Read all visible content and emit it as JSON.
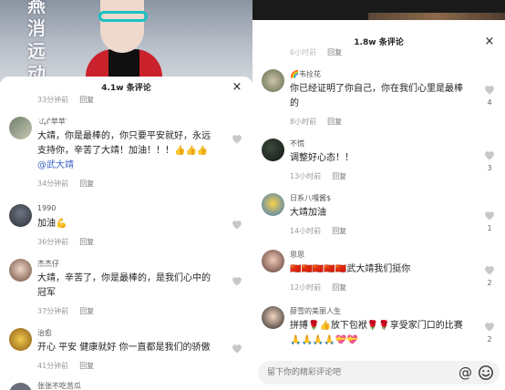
{
  "left": {
    "video_title_art": "燕消远动",
    "sheet_title": "4.1w 条评论",
    "close_glyph": "×",
    "top_meta": {
      "time": "33分钟前",
      "reply": "回复"
    },
    "comments": [
      {
        "name": "ᐝᦔ៹ᒌ苹苹ᐝ",
        "text": "大靖，你是最棒的，你只要平安就好，永远支持你，辛苦了大靖！加油！！！👍👍👍 ",
        "mention": "@武大靖",
        "time": "34分钟前",
        "reply": "回复",
        "likes": ""
      },
      {
        "name": "1990",
        "text": "加油💪",
        "time": "36分钟前",
        "reply": "回复",
        "likes": ""
      },
      {
        "name": "杰杰仔",
        "text": "大靖，辛苦了，你是最棒的，是我们心中的冠军",
        "time": "37分钟前",
        "reply": "回复",
        "likes": ""
      },
      {
        "name": "治愈",
        "text": "开心 平安 健康就好 你一直都是我们的骄傲",
        "time": "41分钟前",
        "reply": "回复",
        "likes": ""
      },
      {
        "name": "张张不吃苦瓜",
        "text": "",
        "time": "",
        "reply": "",
        "likes": ""
      }
    ]
  },
  "right": {
    "sheet_title": "1.8w 条评论",
    "close_glyph": "×",
    "top_meta": {
      "time": "6小时前",
      "reply": "回复"
    },
    "comments": [
      {
        "name": "🌈韦拴花",
        "text": "你已经证明了你自己，你在我们心里是最棒的",
        "time": "8小时前",
        "reply": "回复",
        "likes": "4"
      },
      {
        "name": "不慌",
        "text": "调整好心态！！",
        "time": "13小时前",
        "reply": "回复",
        "likes": "3"
      },
      {
        "name": "日系八嘎酱$",
        "text": "大靖加油",
        "time": "14小时前",
        "reply": "回复",
        "likes": "1"
      },
      {
        "name": "思思",
        "text": "🇨🇳🇨🇳🇨🇳🇨🇳🇨🇳武大靖我们挺你",
        "time": "12小时前",
        "reply": "回复",
        "likes": "2"
      },
      {
        "name": "薛雪的美丽人生",
        "text": "拼搏🌹👍放下包袱🌹🌹享受家门口的比赛🙏🙏🙏🙏💝💝",
        "time": "",
        "reply": "",
        "likes": "2"
      }
    ],
    "input_placeholder": "留下你的精彩评论吧",
    "at_glyph": "@"
  },
  "colors": {
    "mention": "#3a62c7",
    "like_outline": "#c8c8c8"
  }
}
